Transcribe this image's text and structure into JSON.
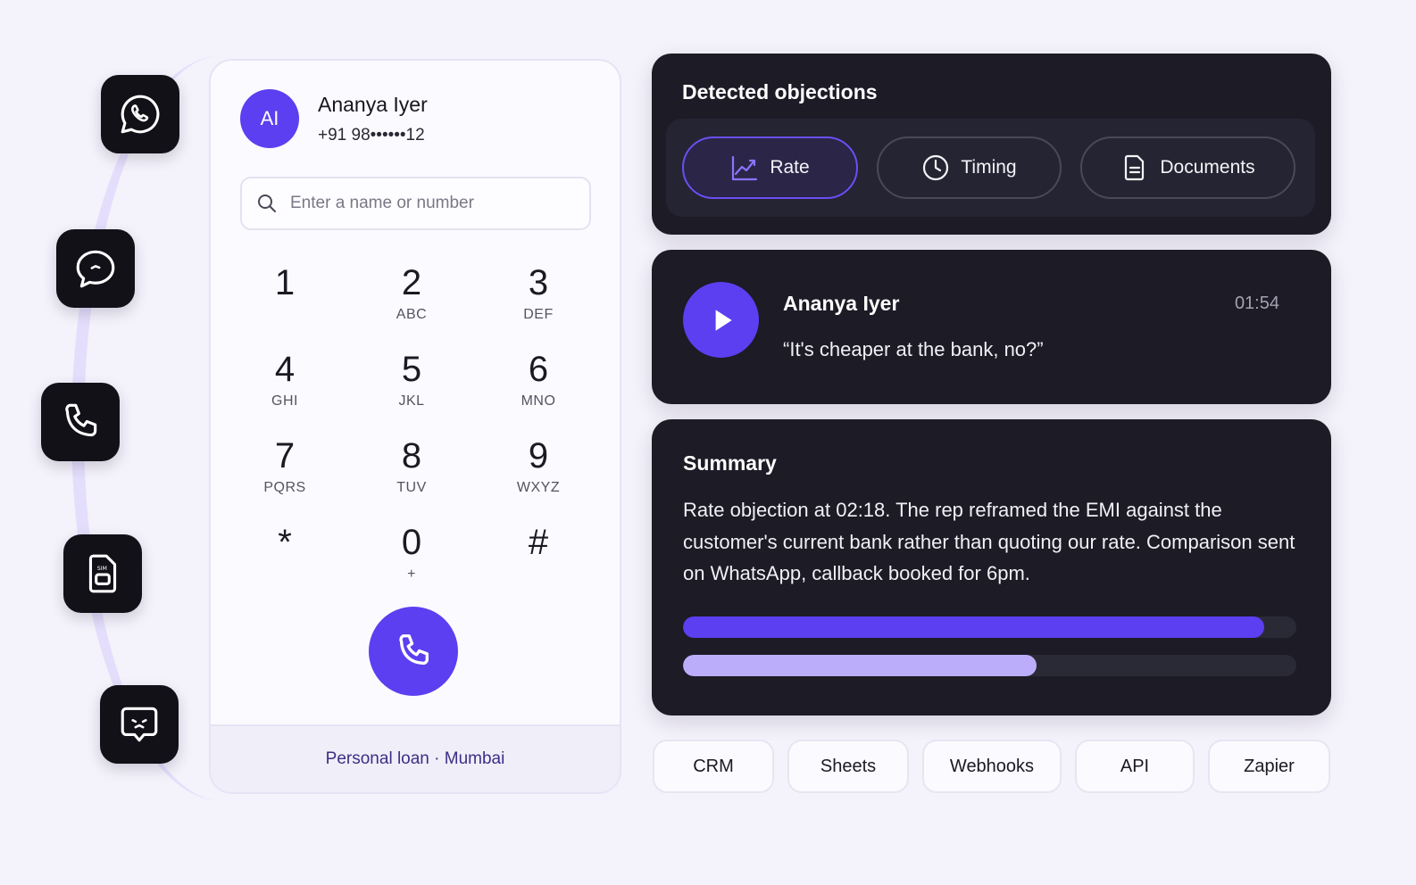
{
  "channels": [
    {
      "icon": "whatsapp-icon"
    },
    {
      "icon": "chat-bubble-icon"
    },
    {
      "icon": "phone-icon"
    },
    {
      "icon": "sim-card-icon"
    },
    {
      "icon": "message-icon"
    }
  ],
  "dialer": {
    "contact": {
      "initials": "AI",
      "name": "Ananya Iyer",
      "phone": "+91 98••••••12"
    },
    "search": {
      "placeholder": "Enter a name or number",
      "value": ""
    },
    "keys": [
      {
        "digit": "1",
        "letters": ""
      },
      {
        "digit": "2",
        "letters": "ABC"
      },
      {
        "digit": "3",
        "letters": "DEF"
      },
      {
        "digit": "4",
        "letters": "GHI"
      },
      {
        "digit": "5",
        "letters": "JKL"
      },
      {
        "digit": "6",
        "letters": "MNO"
      },
      {
        "digit": "7",
        "letters": "PQRS"
      },
      {
        "digit": "8",
        "letters": "TUV"
      },
      {
        "digit": "9",
        "letters": "WXYZ"
      },
      {
        "digit": "*",
        "letters": ""
      },
      {
        "digit": "0",
        "letters": "+"
      },
      {
        "digit": "#",
        "letters": ""
      }
    ],
    "footer": "Personal loan · Mumbai"
  },
  "objections": {
    "title": "Detected objections",
    "pills": [
      {
        "label": "Rate",
        "icon": "trend-chart-icon",
        "active": true
      },
      {
        "label": "Timing",
        "icon": "clock-icon",
        "active": false
      },
      {
        "label": "Documents",
        "icon": "document-icon",
        "active": false
      }
    ]
  },
  "transcript": {
    "speaker": "Ananya Iyer",
    "timestamp": "01:54",
    "quote": "“It's cheaper at the bank, no?”"
  },
  "summary": {
    "title": "Summary",
    "text": "Rate objection at 02:18. The rep reframed the EMI against the customer's current bank rather than quoting our rate. Comparison sent on WhatsApp, callback booked for 6pm.",
    "bars": [
      {
        "fraction": 0.948,
        "color": "#5b3ff0"
      },
      {
        "fraction": 0.577,
        "color": "#bcadfa"
      }
    ]
  },
  "integrations": [
    "CRM",
    "Sheets",
    "Webhooks",
    "API",
    "Zapier"
  ],
  "colors": {
    "accent": "#5b3ff0",
    "panel": "#1c1b26",
    "background": "#f4f2fb"
  }
}
